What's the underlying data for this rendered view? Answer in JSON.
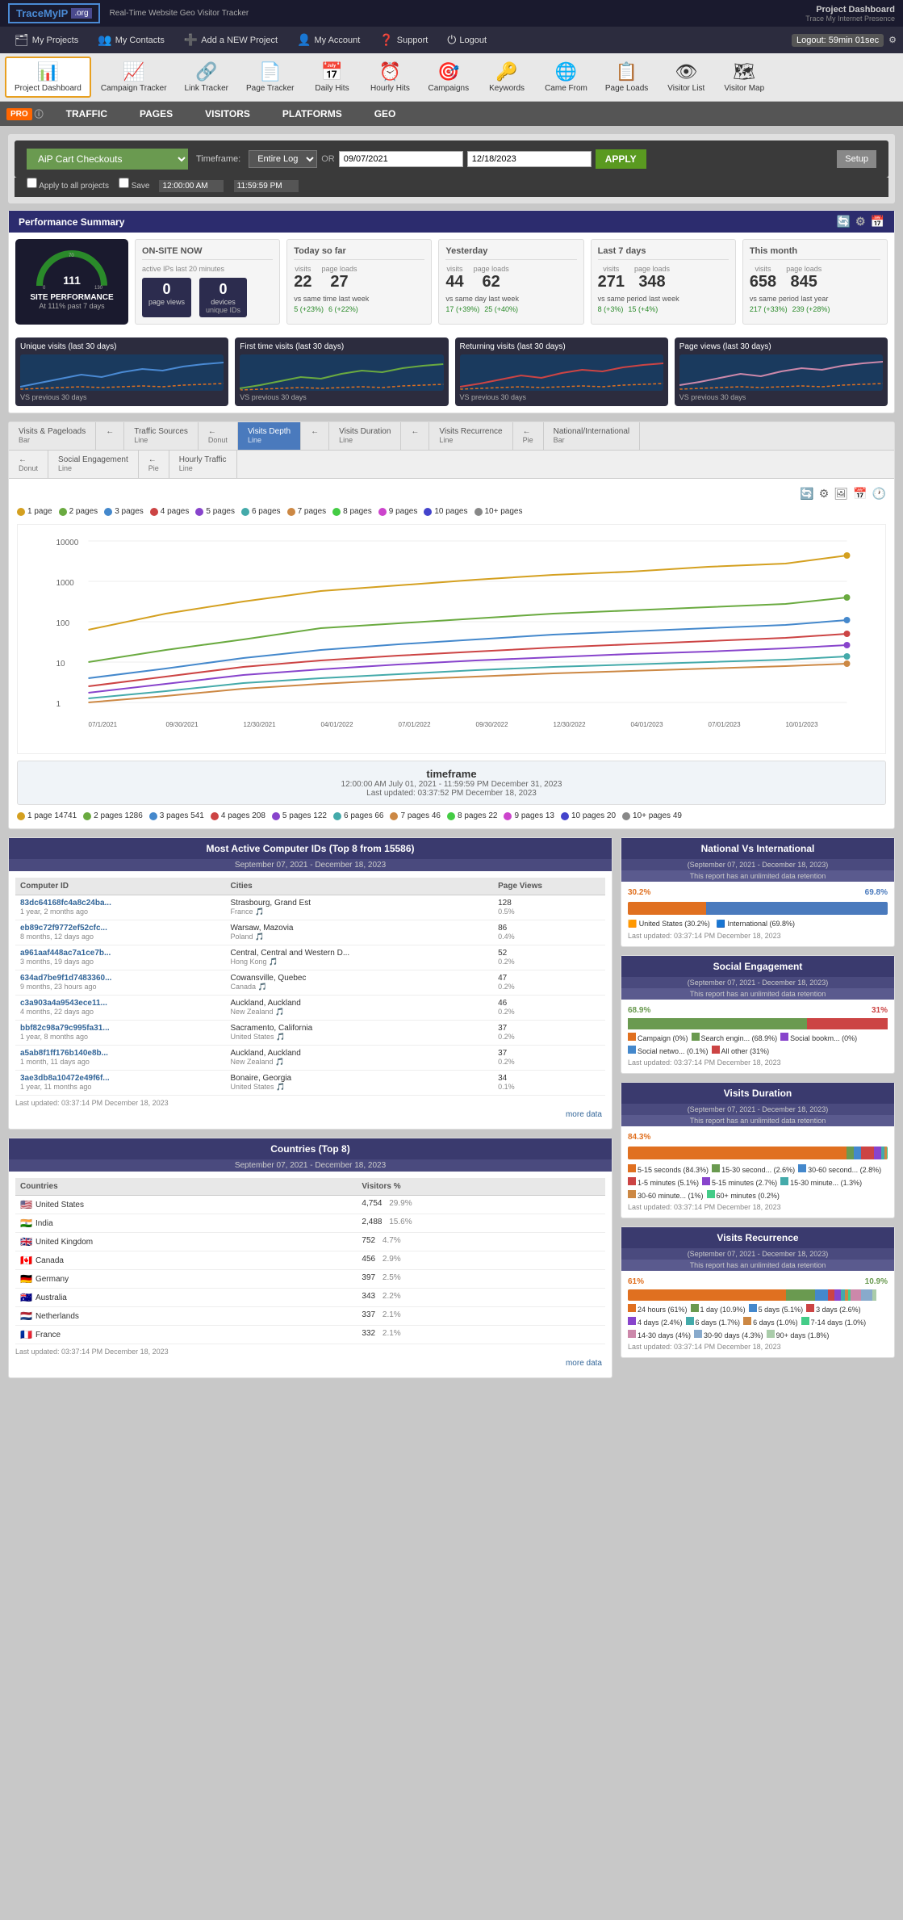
{
  "header": {
    "logo": "TraceMylP.org",
    "tagline": "Real-Time Website Geo Visitor Tracker",
    "project_label": "Project Dashboard",
    "trace_label": "Trace My Internet Presence"
  },
  "nav": {
    "items": [
      {
        "label": "My Projects",
        "icon": "🗂"
      },
      {
        "label": "My Contacts",
        "icon": "👥"
      },
      {
        "label": "Add a NEW Project",
        "icon": "➕"
      },
      {
        "label": "My Account",
        "icon": "👤"
      },
      {
        "label": "Support",
        "icon": "❓"
      },
      {
        "label": "Logout",
        "icon": "⏻"
      }
    ],
    "logout_timer": "Logout: 59min 01sec"
  },
  "icon_tabs": [
    {
      "label": "Project Dashboard",
      "icon": "📊",
      "active": true
    },
    {
      "label": "Campaign Tracker",
      "icon": "📈"
    },
    {
      "label": "Link Tracker",
      "icon": "🔗"
    },
    {
      "label": "Page Tracker",
      "icon": "📄"
    },
    {
      "label": "Daily Hits",
      "icon": "📅"
    },
    {
      "label": "Hourly Hits",
      "icon": "⏰"
    },
    {
      "label": "Campaigns",
      "icon": "🎯"
    },
    {
      "label": "Keywords",
      "icon": "🔑"
    },
    {
      "label": "Came From",
      "icon": "🌐"
    },
    {
      "label": "Page Loads",
      "icon": "📋"
    },
    {
      "label": "Visitor List",
      "icon": "👁"
    },
    {
      "label": "Visitor Map",
      "icon": "🗺"
    }
  ],
  "sub_menu": {
    "items": [
      "TRAFFIC",
      "PAGES",
      "VISITORS",
      "PLATFORMS",
      "GEO"
    ]
  },
  "timeframe": {
    "project_name": "AiP Cart Checkouts",
    "label": "Timeframe:",
    "range_option": "Entire Log",
    "or_label": "OR",
    "start_date": "09/07/2021",
    "end_date": "12/18/2023",
    "start_time": "12:00:00 AM",
    "end_time": "11:59:59 PM",
    "apply_label": "APPLY",
    "setup_label": "Setup",
    "check1": "Apply to all projects",
    "check2": "Save"
  },
  "performance_summary": {
    "title": "Performance Summary",
    "gauge": {
      "value": 111,
      "label": "SITE PERFORMANCE",
      "sub": "At 111% past 7 days"
    },
    "on_site_now": {
      "title": "ON-SITE NOW",
      "sub": "active IPs last 20 minutes",
      "page_views_label": "page views",
      "page_views_val": "0",
      "devices_label": "devices",
      "devices_val": "0",
      "devices_sub": "unique IDs"
    },
    "today": {
      "title": "Today so far",
      "visits": "22",
      "page_loads": "27",
      "vs_label": "vs same time last week",
      "vs_visits": "5",
      "vs_pl": "6",
      "vs_visits_pct": "(+23%)",
      "vs_pl_pct": "(+22%)"
    },
    "yesterday": {
      "title": "Yesterday",
      "visits": "44",
      "page_loads": "62",
      "vs_label": "vs same day last week",
      "vs_visits": "17",
      "vs_pl": "25",
      "vs_visits_pct": "(+39%)",
      "vs_pl_pct": "(+40%)"
    },
    "last7": {
      "title": "Last 7 days",
      "visits": "271",
      "page_loads": "348",
      "vs_label": "vs same period last week",
      "vs_visits": "8",
      "vs_pl": "15",
      "vs_visits_pct": "(+3%)",
      "vs_pl_pct": "(+4%)"
    },
    "this_month": {
      "title": "This month",
      "visits": "658",
      "page_loads": "845",
      "vs_label": "vs same period last year",
      "vs_visits": "217",
      "vs_pl": "239",
      "vs_visits_pct": "(+33%)",
      "vs_pl_pct": "(+28%)"
    }
  },
  "mini_charts": [
    {
      "title": "Unique visits (last 30 days)",
      "vs": "VS previous 30 days"
    },
    {
      "title": "First time visits (last 30 days)",
      "vs": "VS previous 30 days"
    },
    {
      "title": "Returning visits (last 30 days)",
      "vs": "VS previous 30 days"
    },
    {
      "title": "Page views (last 30 days)",
      "vs": "VS previous 30 days"
    }
  ],
  "chart_tabs": {
    "row1": [
      {
        "label": "Visits & Pageloads",
        "sub": "Bar",
        "active": false
      },
      {
        "label": "←",
        "sub": ""
      },
      {
        "label": "Traffic Sources",
        "sub": "Line",
        "active": false
      },
      {
        "label": "←",
        "sub": "Donut"
      },
      {
        "label": "Visits Depth",
        "sub": "Line",
        "active": true
      },
      {
        "label": "←",
        "sub": ""
      },
      {
        "label": "Visits Duration",
        "sub": "Line",
        "active": false
      },
      {
        "label": "←",
        "sub": ""
      },
      {
        "label": "Visits Recurrence",
        "sub": "Line",
        "active": false
      },
      {
        "label": "←",
        "sub": "Pie"
      },
      {
        "label": "National/International",
        "sub": "Bar",
        "active": false
      }
    ],
    "row2": [
      {
        "label": "←",
        "sub": "Donut"
      },
      {
        "label": "Social Engagement",
        "sub": "Line",
        "active": false
      },
      {
        "label": "←",
        "sub": "Pie"
      },
      {
        "label": "Hourly Traffic",
        "sub": "Line",
        "active": false
      }
    ]
  },
  "visits_depth_chart": {
    "title": "Visits Depth Line",
    "timeframe": {
      "title": "timeframe",
      "detail": "12:00:00 AM July 01, 2021 - 11:59:59 PM December 31, 2023",
      "last_updated": "Last updated: 03:37:52 PM December 18, 2023"
    },
    "legend": [
      {
        "label": "1 page",
        "color": "#d4a020",
        "value": "14741"
      },
      {
        "label": "2 pages",
        "color": "#6aaa40",
        "value": "1286"
      },
      {
        "label": "3 pages",
        "color": "#4488cc",
        "value": "541"
      },
      {
        "label": "4 pages",
        "color": "#cc4444",
        "value": "208"
      },
      {
        "label": "5 pages",
        "color": "#8844cc",
        "value": "122"
      },
      {
        "label": "6 pages",
        "color": "#44aaaa",
        "value": "66"
      },
      {
        "label": "7 pages",
        "color": "#cc8844",
        "value": "46"
      },
      {
        "label": "8 pages",
        "color": "#44cc44",
        "value": "22"
      },
      {
        "label": "9 pages",
        "color": "#cc44cc",
        "value": "13"
      },
      {
        "label": "10 pages",
        "color": "#4444cc",
        "value": "20"
      },
      {
        "label": "10+ pages",
        "color": "#888888",
        "value": "49"
      }
    ],
    "y_labels": [
      "10000",
      "1000",
      "100",
      "10",
      "1"
    ],
    "x_labels": [
      "07/1/2021",
      "09/30/2021",
      "12/30/2021",
      "04/01/2022",
      "07/01/2022",
      "09/30/2022",
      "12/30/2022",
      "04/01/2023",
      "07/01/2023",
      "10/01/2023"
    ]
  },
  "most_active_computers": {
    "title": "Most Active Computer IDs",
    "subtitle": "(Top 8 from 15586)",
    "date_range": "September 07, 2021 - December 18, 2023",
    "columns": [
      "Computer ID",
      "Cities",
      "Page Views"
    ],
    "rows": [
      {
        "id": "83dc64168fc4a8c24ba...",
        "age": "1 year, 2 months ago",
        "city": "Strasbourg, Grand Est",
        "country": "France",
        "pv": "128",
        "pct": "0.5%"
      },
      {
        "id": "eb89c72f9772ef52cfc...",
        "age": "8 months, 12 days ago",
        "city": "Warsaw, Mazovia",
        "country": "Poland",
        "pv": "86",
        "pct": "0.4%"
      },
      {
        "id": "a961aaf448ac7a1ce7b...",
        "age": "3 months, 19 days ago",
        "city": "Central, Central and Western D...",
        "country": "Hong Kong",
        "pv": "52",
        "pct": "0.2%"
      },
      {
        "id": "634ad7be9f1d7483360...",
        "age": "9 months, 23 hours ago",
        "city": "Cowansville, Quebec",
        "country": "Canada",
        "pv": "47",
        "pct": "0.2%"
      },
      {
        "id": "c3a903a4a9543ece11...",
        "age": "4 months, 22 days ago",
        "city": "Auckland, Auckland",
        "country": "New Zealand",
        "pv": "46",
        "pct": "0.2%"
      },
      {
        "id": "bbf82c98a79c995fa31...",
        "age": "1 year, 8 months ago",
        "city": "Sacramento, California",
        "country": "United States",
        "pv": "37",
        "pct": "0.2%"
      },
      {
        "id": "a5ab8f1ff176b140e8b...",
        "age": "1 month, 11 days ago",
        "city": "Auckland, Auckland",
        "country": "New Zealand",
        "pv": "37",
        "pct": "0.2%"
      },
      {
        "id": "3ae3db8a10472e49f6f...",
        "age": "1 year, 11 months ago",
        "city": "Bonaire, Georgia",
        "country": "United States",
        "pv": "34",
        "pct": "0.1%"
      }
    ],
    "last_updated": "Last updated: 03:37:14 PM December 18, 2023",
    "more_data": "more data"
  },
  "countries": {
    "title": "Countries",
    "subtitle": "(Top 8)",
    "date_range": "September 07, 2021 - December 18, 2023",
    "columns": [
      "Countries",
      "Visitors %"
    ],
    "rows": [
      {
        "name": "United States",
        "visitors": "4,754",
        "pct": "29.9%",
        "flag": "🇺🇸"
      },
      {
        "name": "India",
        "visitors": "2,488",
        "pct": "15.6%",
        "flag": "🇮🇳"
      },
      {
        "name": "United Kingdom",
        "visitors": "752",
        "pct": "4.7%",
        "flag": "🇬🇧"
      },
      {
        "name": "Canada",
        "visitors": "456",
        "pct": "2.9%",
        "flag": "🇨🇦"
      },
      {
        "name": "Germany",
        "visitors": "397",
        "pct": "2.5%",
        "flag": "🇩🇪"
      },
      {
        "name": "Australia",
        "visitors": "343",
        "pct": "2.2%",
        "flag": "🇦🇺"
      },
      {
        "name": "Netherlands",
        "visitors": "337",
        "pct": "2.1%",
        "flag": "🇳🇱"
      },
      {
        "name": "France",
        "visitors": "332",
        "pct": "2.1%",
        "flag": "🇫🇷"
      }
    ],
    "last_updated": "Last updated: 03:37:14 PM December 18, 2023",
    "more_data": "more data"
  },
  "national_vs_international": {
    "title": "National Vs International",
    "subtitle": "(September 07, 2021 - December 18, 2023)",
    "retention": "This report has an unlimited data retention",
    "us_pct": "30.2%",
    "intl_pct": "69.8%",
    "us_fill": 30.2,
    "intl_fill": 69.8,
    "us_label": "United States (30.2%)",
    "intl_label": "International (69.8%)",
    "last_updated": "Last updated: 03:37:14 PM December 18, 2023"
  },
  "social_engagement": {
    "title": "Social Engagement",
    "subtitle": "(September 07, 2021 - December 18, 2023)",
    "retention": "This report has an unlimited data retention",
    "campaign_pct": 68.9,
    "search_pct": 0,
    "social_pct": 0.1,
    "bookm_pct": 0,
    "other_pct": 31,
    "bar_pct": "68.9%",
    "bar_right": "31%",
    "labels": [
      {
        "label": "Campaign (0%)",
        "color": "#e07020"
      },
      {
        "label": "Search engin... (68.9%)",
        "color": "#6a9a50"
      },
      {
        "label": "Social bookm... (0%)",
        "color": "#8844cc"
      },
      {
        "label": "Social netwo... (0.1%)",
        "color": "#4488cc"
      },
      {
        "label": "All other (31%)",
        "color": "#cc4444"
      }
    ],
    "last_updated": "Last updated: 03:37:14 PM December 18, 2023"
  },
  "visits_duration": {
    "title": "Visits Duration",
    "subtitle": "(September 07, 2021 - December 18, 2023)",
    "retention": "This report has an unlimited data retention",
    "bar_pct": "84.3%",
    "segments": [
      {
        "label": "5-15 seconds (84.3%)",
        "color": "#e07020",
        "pct": 84.3
      },
      {
        "label": "15-30 second... (2.6%)",
        "color": "#6a9a50",
        "pct": 2.6
      },
      {
        "label": "30-60 second... (2.8%)",
        "color": "#4488cc",
        "pct": 2.8
      },
      {
        "label": "1-5 minutes (5.1%)",
        "color": "#cc4444",
        "pct": 5.1
      },
      {
        "label": "5-15 minutes (2.7%)",
        "color": "#8844cc",
        "pct": 2.7
      },
      {
        "label": "15-30 minute... (1.3%)",
        "color": "#44aaaa",
        "pct": 1.3
      },
      {
        "label": "30-60 minute... (1%)",
        "color": "#cc8844",
        "pct": 1.0
      },
      {
        "label": "60+ minutes (0.2%)",
        "color": "#44cc88",
        "pct": 0.2
      }
    ],
    "last_updated": "Last updated: 03:37:14 PM December 18, 2023"
  },
  "visits_recurrence": {
    "title": "Visits Recurrence",
    "subtitle": "(September 07, 2021 - December 18, 2023)",
    "retention": "This report has an unlimited data retention",
    "bar_pct": "61%",
    "bar_right": "10.9%",
    "segments": [
      {
        "label": "24 hours (61%)",
        "color": "#e07020",
        "pct": 61
      },
      {
        "label": "1 day (10.9%)",
        "color": "#6a9a50",
        "pct": 10.9
      },
      {
        "label": "5 days (5.1%)",
        "color": "#4488cc",
        "pct": 5.1
      },
      {
        "label": "3 days (2.6%)",
        "color": "#cc4444",
        "pct": 2.6
      },
      {
        "label": "4 days (2.4%)",
        "color": "#8844cc",
        "pct": 2.4
      },
      {
        "label": "6 days (1.7%)",
        "color": "#44aaaa",
        "pct": 1.7
      },
      {
        "label": "6 days (1.0%)",
        "color": "#cc8844",
        "pct": 1.0
      },
      {
        "label": "7-14 days (1.0%)",
        "color": "#44cc88",
        "pct": 1.0
      },
      {
        "label": "14-30 days (4%)",
        "color": "#cc88aa",
        "pct": 4.0
      },
      {
        "label": "30-90 days (4.3%)",
        "color": "#88aacc",
        "pct": 4.3
      },
      {
        "label": "90+ days (1.8%)",
        "color": "#aaccaa",
        "pct": 1.8
      }
    ],
    "last_updated": "Last updated: 03:37:14 PM December 18, 2023"
  }
}
